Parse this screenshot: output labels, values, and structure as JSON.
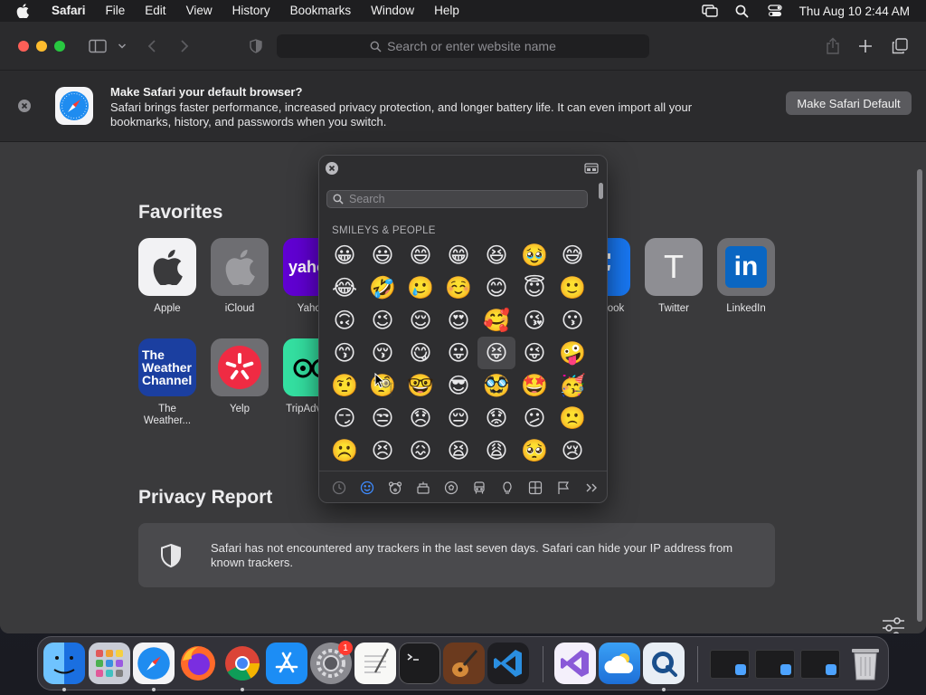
{
  "menubar": {
    "app_name": "Safari",
    "items": [
      "File",
      "Edit",
      "View",
      "History",
      "Bookmarks",
      "Window",
      "Help"
    ],
    "clock": "Thu Aug 10  2:44 AM"
  },
  "toolbar": {
    "url_placeholder": "Search or enter website name"
  },
  "banner": {
    "title": "Make Safari your default browser?",
    "text": "Safari brings faster performance, increased privacy protection, and longer battery life. It can even import all your bookmarks, history, and passwords when you switch.",
    "button": "Make Safari Default"
  },
  "favorites": {
    "title": "Favorites",
    "items": [
      {
        "label": "Apple"
      },
      {
        "label": "iCloud"
      },
      {
        "label": "Yahoo"
      },
      {
        "label": "Facebook"
      },
      {
        "label": "Twitter"
      },
      {
        "label": "LinkedIn"
      },
      {
        "label": "The Weather..."
      },
      {
        "label": "Yelp"
      },
      {
        "label": "TripAdvisor"
      }
    ],
    "tile_text": {
      "yahoo": "yahoo",
      "twitter": "T",
      "linkedin": "in",
      "weather_line1": "The",
      "weather_line2": "Weather",
      "weather_line3": "Channel"
    }
  },
  "privacy": {
    "title": "Privacy Report",
    "text": "Safari has not encountered any trackers in the last seven days. Safari can hide your IP address from known trackers."
  },
  "emoji_picker": {
    "search_placeholder": "Search",
    "category_title": "SMILEYS & PEOPLE",
    "emojis": [
      "😀",
      "😃",
      "😄",
      "😁",
      "😆",
      "🥹",
      "😅",
      "😂",
      "🤣",
      "🥲",
      "☺️",
      "😊",
      "😇",
      "🙂",
      "🙃",
      "😉",
      "😌",
      "😍",
      "🥰",
      "😘",
      "😗",
      "😙",
      "😚",
      "😋",
      "😛",
      "😝",
      "😜",
      "🤪",
      "🤨",
      "🧐",
      "🤓",
      "😎",
      "🥸",
      "🤩",
      "🥳",
      "😏",
      "😒",
      "😞",
      "😔",
      "😟",
      "😕",
      "🙁",
      "☹️",
      "😣",
      "😖",
      "😫",
      "😩",
      "🥺",
      "😢"
    ],
    "hovered_index": 25,
    "active_category": "smileys"
  },
  "dock": {
    "settings_badge": "1"
  },
  "colors": {
    "accent": "#3e8bff",
    "traffic_red": "#fe5f57",
    "traffic_yellow": "#febc2e",
    "traffic_green": "#28c840"
  }
}
